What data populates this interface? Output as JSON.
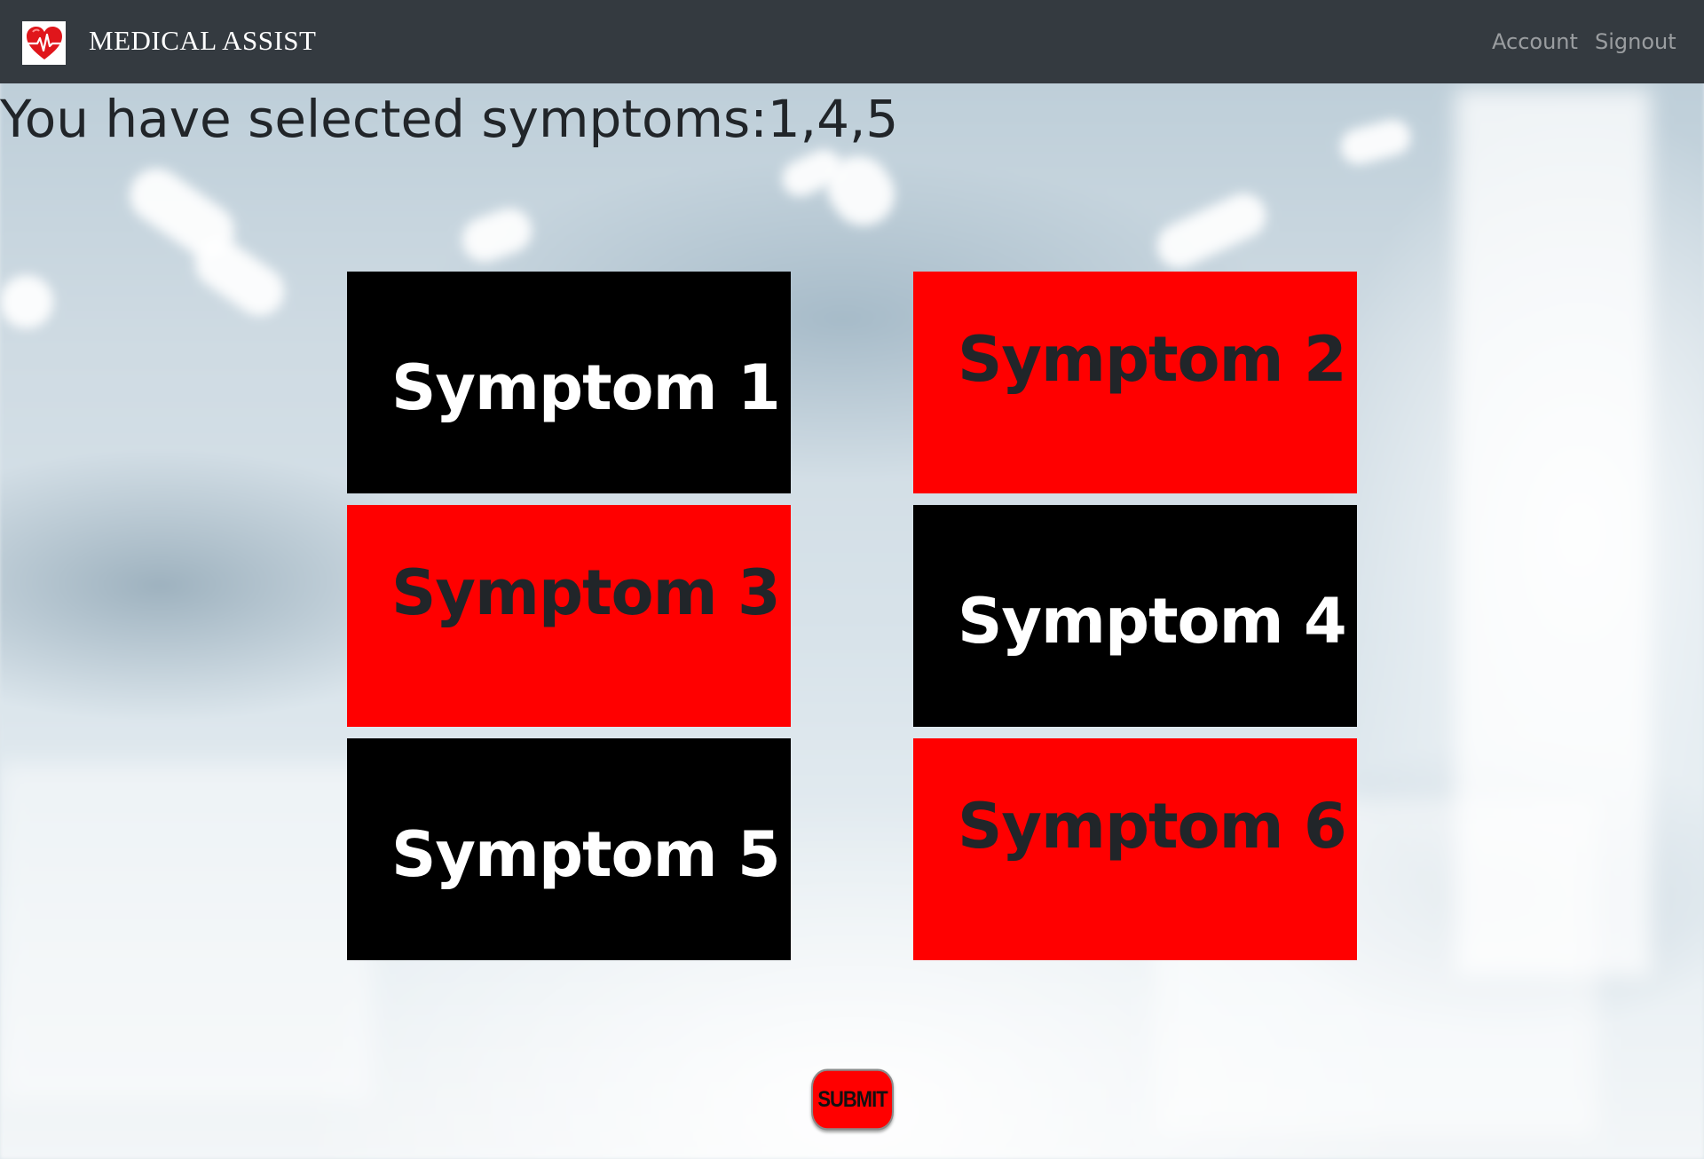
{
  "app": {
    "title": "MEDICAL ASSIST",
    "logo_icon": "heart-pulse-icon"
  },
  "nav": {
    "items": [
      {
        "label": "Account"
      },
      {
        "label": "Signout"
      }
    ]
  },
  "main": {
    "heading": "You have selected symptoms:1,4,5",
    "symptoms": [
      {
        "label": "Symptom 1",
        "selected": true
      },
      {
        "label": "Symptom 2",
        "selected": false
      },
      {
        "label": "Symptom 3",
        "selected": false
      },
      {
        "label": "Symptom 4",
        "selected": true
      },
      {
        "label": "Symptom 5",
        "selected": true
      },
      {
        "label": "Symptom 6",
        "selected": false
      }
    ],
    "submit_label": "SUBMIT"
  },
  "colors": {
    "navbar": "#343a40",
    "selected_tile": "#000000",
    "unselected_tile": "#ff0000",
    "submit": "#ff0000"
  }
}
